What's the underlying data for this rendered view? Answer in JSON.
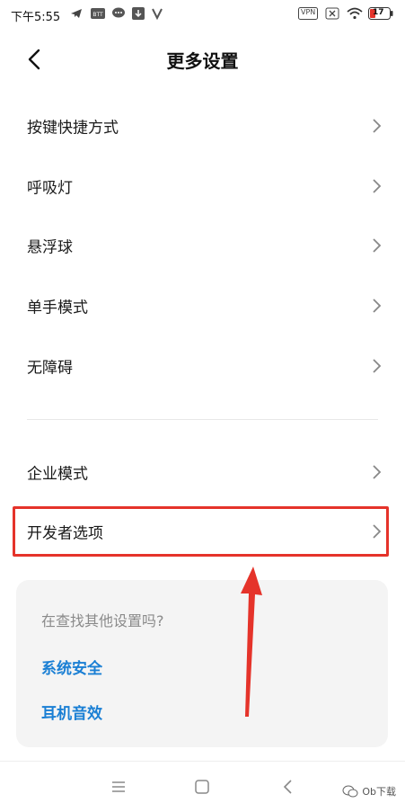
{
  "status_bar": {
    "time": "下午5:55",
    "vpn_label": "VPN",
    "battery": "17"
  },
  "header": {
    "title": "更多设置",
    "back_icon": "chevron-left-icon"
  },
  "settings_items": [
    {
      "label": "按键快捷方式"
    },
    {
      "label": "呼吸灯"
    },
    {
      "label": "悬浮球"
    },
    {
      "label": "单手模式"
    },
    {
      "label": "无障碍"
    },
    {
      "label": "企业模式"
    },
    {
      "label": "开发者选项"
    }
  ],
  "search_card": {
    "question": "在查找其他设置吗?",
    "links": [
      "系统安全",
      "耳机音效"
    ]
  },
  "nav_bar": {
    "menu_icon": "menu-icon",
    "home_icon": "square-home-icon",
    "back_icon": "triangle-back-icon"
  },
  "watermark": {
    "text": "Ob下载"
  },
  "colors": {
    "accent_link": "#1a7fd4",
    "highlight_red": "#e5332a"
  }
}
